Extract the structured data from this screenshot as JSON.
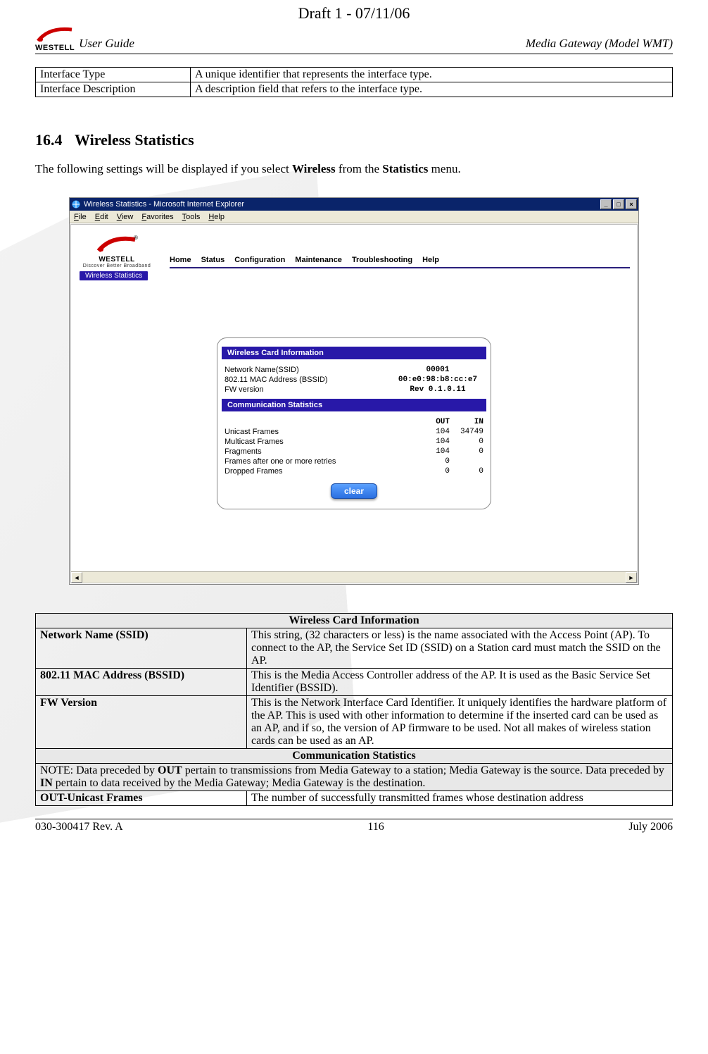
{
  "draft_header": "Draft 1 - 07/11/06",
  "logo": {
    "wordmark_large": "WESTELL",
    "wordmark_small": "WESTELL",
    "tagline": "Discover Better Broadband"
  },
  "header": {
    "left": "User Guide",
    "right": "Media Gateway (Model WMT)"
  },
  "top_table": {
    "rows": [
      {
        "label": "Interface Type",
        "value": "A unique identifier that represents the interface type."
      },
      {
        "label": "Interface Description",
        "value": "A description field that refers to the interface type."
      }
    ]
  },
  "section": {
    "number": "16.4",
    "title": "Wireless Statistics"
  },
  "intro_html": "The following settings will be displayed if you select <b>Wireless</b> from the <b>Statistics</b> menu.",
  "screenshot": {
    "window_title": "Wireless Statistics - Microsoft Internet Explorer",
    "menubar": [
      "File",
      "Edit",
      "View",
      "Favorites",
      "Tools",
      "Help"
    ],
    "nav": [
      "Home",
      "Status",
      "Configuration",
      "Maintenance",
      "Troubleshooting",
      "Help"
    ],
    "subnav": "Wireless Statistics",
    "panel": {
      "sec1_title": "Wireless Card Information",
      "sec1_rows": [
        {
          "label": "Network Name(SSID)",
          "value": "00001"
        },
        {
          "label": "802.11 MAC Address (BSSID)",
          "value": "00:e0:98:b8:cc:e7"
        },
        {
          "label": "FW version",
          "value": "Rev 0.1.0.11"
        }
      ],
      "sec2_title": "Communication Statistics",
      "cols": {
        "out": "OUT",
        "in": "IN"
      },
      "sec2_rows": [
        {
          "label": "Unicast Frames",
          "out": "104",
          "in": "34749"
        },
        {
          "label": "Multicast Frames",
          "out": "104",
          "in": "0"
        },
        {
          "label": "Fragments",
          "out": "104",
          "in": "0"
        },
        {
          "label": "Frames after one or more retries",
          "out": "0",
          "in": ""
        },
        {
          "label": "Dropped Frames",
          "out": "0",
          "in": "0"
        }
      ],
      "clear_btn": "clear"
    }
  },
  "info_table": {
    "hdr1": "Wireless Card Information",
    "rows1": [
      {
        "label": "Network Name (SSID)",
        "value": "This string, (32 characters or less) is the name associated with the Access Point (AP). To connect to the AP, the Service Set ID (SSID) on a Station card must match the SSID on the AP."
      },
      {
        "label": "802.11 MAC Address (BSSID)",
        "value": "This is the Media Access Controller address of the AP. It is used as the Basic Service Set Identifier (BSSID)."
      },
      {
        "label": "FW Version",
        "value": "This is the Network Interface Card Identifier. It uniquely identifies the hardware platform of the AP. This is used with other information to determine if the inserted card can be used as an AP, and if so, the version of AP firmware to be used. Not all makes of wireless station cards can be used as an AP."
      }
    ],
    "hdr2": "Communication Statistics",
    "note_html": "NOTE: Data preceded by <b>OUT</b> pertain to transmissions from Media Gateway to a station; Media Gateway is the source. Data preceded by <b>IN</b> pertain to data received by the Media Gateway; Media Gateway is the destination.",
    "rows2": [
      {
        "label": "OUT-Unicast Frames",
        "value": "The number of successfully transmitted frames whose destination address"
      }
    ]
  },
  "footer": {
    "left": "030-300417 Rev. A",
    "center": "116",
    "right": "July 2006"
  }
}
